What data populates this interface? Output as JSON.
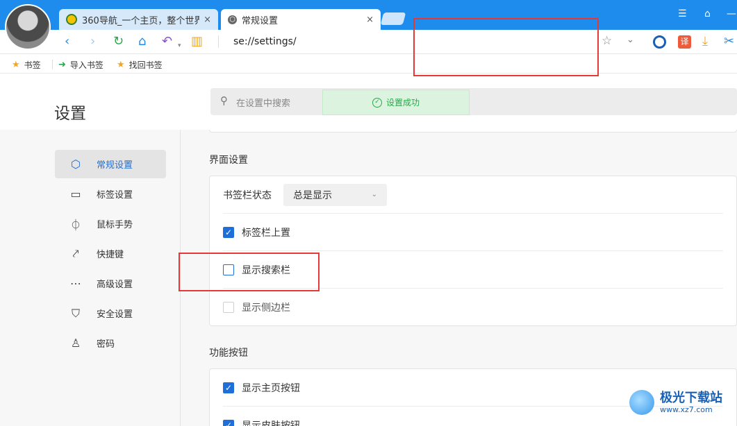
{
  "browser": {
    "tabs": [
      {
        "title": "360导航_一个主页，整个世界",
        "close": "×",
        "active": false
      },
      {
        "title": "常规设置",
        "close": "×",
        "active": true
      }
    ],
    "window_controls": [
      "☰",
      "⌂",
      "—"
    ],
    "address": "se://settings/",
    "bookmarks": [
      {
        "label": "书签",
        "icon": "star-icon"
      },
      {
        "label": "导入书签",
        "icon": "import-icon"
      },
      {
        "label": "找回书签",
        "icon": "star-icon"
      }
    ],
    "ext_translate_label": "译"
  },
  "settings": {
    "title": "设置",
    "search_placeholder": "在设置中搜索",
    "toast": "设置成功",
    "nav": [
      {
        "label": "常规设置",
        "icon": "hexagon-icon",
        "active": true
      },
      {
        "label": "标签设置",
        "icon": "laptop-icon",
        "active": false
      },
      {
        "label": "鼠标手势",
        "icon": "mouse-icon",
        "active": false
      },
      {
        "label": "快捷键",
        "icon": "shortcut-icon",
        "active": false
      },
      {
        "label": "高级设置",
        "icon": "more-icon",
        "active": false
      },
      {
        "label": "安全设置",
        "icon": "shield-icon",
        "active": false
      },
      {
        "label": "密码",
        "icon": "user-icon",
        "active": false
      }
    ],
    "interface_section": {
      "title": "界面设置",
      "bookmark_bar_label": "书签栏状态",
      "bookmark_bar_value": "总是显示",
      "options": [
        {
          "label": "标签栏上置",
          "checked": true,
          "disabled": false
        },
        {
          "label": "显示搜索栏",
          "checked": false,
          "disabled": false
        },
        {
          "label": "显示侧边栏",
          "checked": false,
          "disabled": true
        }
      ]
    },
    "function_section": {
      "title": "功能按钮",
      "options": [
        {
          "label": "显示主页按钮",
          "checked": true
        },
        {
          "label": "显示皮肤按钮",
          "checked": true
        }
      ]
    }
  },
  "watermark": {
    "name": "极光下载站",
    "url": "www.xz7.com"
  },
  "colors": {
    "accent": "#1e6fd9",
    "titlebar": "#1e8cec",
    "success": "#2aa84a",
    "highlight": "#e53935"
  }
}
